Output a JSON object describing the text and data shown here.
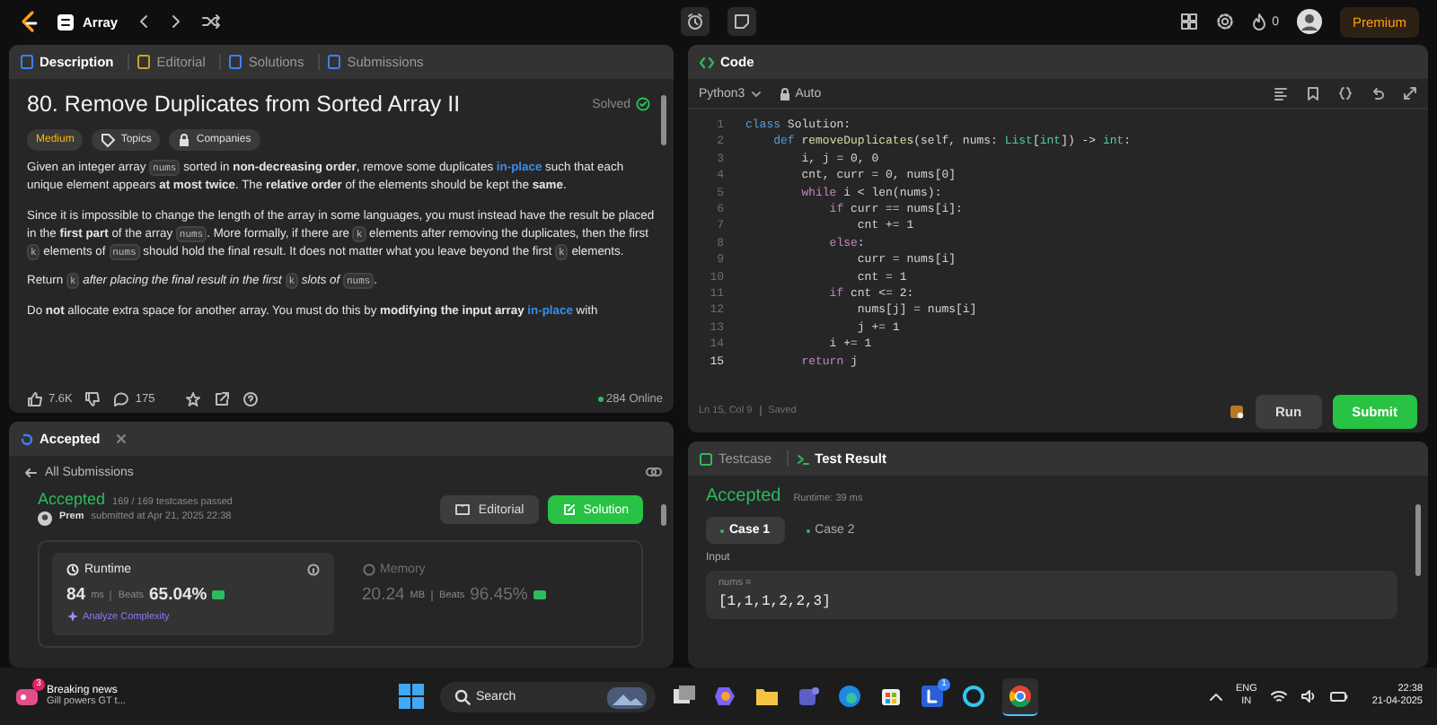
{
  "top_bar": {
    "problem_list": "Array",
    "streak": "0",
    "premium": "Premium"
  },
  "description_panel": {
    "tabs": [
      {
        "label": "Description",
        "selected": true
      },
      {
        "label": "Editorial",
        "selected": false
      },
      {
        "label": "Solutions",
        "selected": false
      },
      {
        "label": "Submissions",
        "selected": false
      }
    ],
    "title": "80. Remove Duplicates from Sorted Array II",
    "status": "Solved",
    "difficulty": "Medium",
    "tags": [
      "Topics",
      "Companies"
    ],
    "paragraphs": [
      [
        {
          "kind": "text",
          "text": "Given an integer array "
        },
        {
          "kind": "code",
          "text": "nums"
        },
        {
          "kind": "text",
          "text": " sorted in **non-decreasing order**, remove some duplicates "
        },
        {
          "kind": "link",
          "text": "in-place"
        },
        {
          "kind": "text",
          "text": " such that each unique element appears **at most twice**. The **relative order** of the elements should be kept the **same**."
        }
      ],
      [
        {
          "kind": "text",
          "text": "Since it is impossible to change the length of the array in some languages, you must instead have the result be placed in the **first part** of the array "
        },
        {
          "kind": "code",
          "text": "nums"
        },
        {
          "kind": "text",
          "text": ". More formally, if there are "
        },
        {
          "kind": "code",
          "text": "k"
        },
        {
          "kind": "text",
          "text": " elements after removing the duplicates, then the first "
        },
        {
          "kind": "code",
          "text": "k"
        },
        {
          "kind": "text",
          "text": " elements of "
        },
        {
          "kind": "code",
          "text": "nums"
        },
        {
          "kind": "text",
          "text": " should hold the final result. It does not matter what you leave beyond the first "
        },
        {
          "kind": "code",
          "text": "k"
        },
        {
          "kind": "text",
          "text": " elements."
        }
      ],
      [
        {
          "kind": "text",
          "text": "Return "
        },
        {
          "kind": "code",
          "text": "k"
        },
        {
          "kind": "text",
          "text": " *after placing the final result in the first* "
        },
        {
          "kind": "code",
          "text": "k"
        },
        {
          "kind": "text",
          "text": " *slots of* "
        },
        {
          "kind": "code",
          "text": "nums"
        },
        {
          "kind": "text",
          "text": "."
        }
      ],
      [
        {
          "kind": "text",
          "text": "Do **not** allocate extra space for another array. You must do this by **modifying the input array** "
        },
        {
          "kind": "link",
          "text": "in-place"
        },
        {
          "kind": "text",
          "text": " with"
        }
      ]
    ],
    "footer": {
      "likes": "7.6K",
      "comments": "175",
      "online": "284 Online"
    }
  },
  "result_panel": {
    "tab": "Accepted",
    "back_link": "All Submissions",
    "status": "Accepted",
    "testcases": "169 / 169 testcases passed",
    "user": "Prem",
    "submitted": "submitted at Apr 21, 2025 22:38",
    "buttons": [
      {
        "label": "Editorial",
        "kind": "secondary"
      },
      {
        "label": "Solution",
        "kind": "primary"
      }
    ],
    "metrics": [
      {
        "label": "Runtime",
        "value": "84",
        "unit": "ms",
        "beats_label": "Beats",
        "beats": "65.04%",
        "link": "Analyze Complexity",
        "selected": true
      },
      {
        "label": "Memory",
        "value": "20.24",
        "unit": "MB",
        "beats_label": "Beats",
        "beats": "96.45%",
        "selected": false
      }
    ]
  },
  "code_panel": {
    "title": "Code",
    "language": "Python3",
    "mode": "Auto",
    "lines": [
      {
        "number": "1",
        "current": false,
        "tokens": [
          {
            "kind": "kw",
            "text": "class"
          },
          {
            "kind": "tx",
            "text": " Solution:"
          }
        ]
      },
      {
        "number": "2",
        "current": false,
        "tokens": [
          {
            "kind": "kw",
            "text": "    def"
          },
          {
            "kind": "fn",
            "text": " removeDuplicates"
          },
          {
            "kind": "tx",
            "text": "(self, nums: "
          },
          {
            "kind": "ty",
            "text": "List"
          },
          {
            "kind": "tx",
            "text": "["
          },
          {
            "kind": "ty",
            "text": "int"
          },
          {
            "kind": "tx",
            "text": "]) -> "
          },
          {
            "kind": "ty",
            "text": "int"
          },
          {
            "kind": "tx",
            "text": ":"
          }
        ]
      },
      {
        "number": "3",
        "current": false,
        "tokens": [
          {
            "kind": "tx",
            "text": "        i, j = 0, 0"
          }
        ]
      },
      {
        "number": "4",
        "current": false,
        "tokens": [
          {
            "kind": "tx",
            "text": "        cnt, curr = 0, nums[0]"
          }
        ]
      },
      {
        "number": "5",
        "current": false,
        "tokens": [
          {
            "kind": "ctl",
            "text": "        while"
          },
          {
            "kind": "tx",
            "text": " i < len(nums):"
          }
        ]
      },
      {
        "number": "6",
        "current": false,
        "tokens": [
          {
            "kind": "ctl",
            "text": "            if"
          },
          {
            "kind": "tx",
            "text": " curr == nums[i]:"
          }
        ]
      },
      {
        "number": "7",
        "current": false,
        "tokens": [
          {
            "kind": "tx",
            "text": "                cnt += 1"
          }
        ]
      },
      {
        "number": "8",
        "current": false,
        "tokens": [
          {
            "kind": "ctl",
            "text": "            else"
          },
          {
            "kind": "tx",
            "text": ":"
          }
        ]
      },
      {
        "number": "9",
        "current": false,
        "tokens": [
          {
            "kind": "tx",
            "text": "                curr = nums[i]"
          }
        ]
      },
      {
        "number": "10",
        "current": false,
        "tokens": [
          {
            "kind": "tx",
            "text": "                cnt = 1"
          }
        ]
      },
      {
        "number": "11",
        "current": false,
        "tokens": [
          {
            "kind": "ctl",
            "text": "            if"
          },
          {
            "kind": "tx",
            "text": " cnt <= 2:"
          }
        ]
      },
      {
        "number": "12",
        "current": false,
        "tokens": [
          {
            "kind": "tx",
            "text": "                nums[j] = nums[i]"
          }
        ]
      },
      {
        "number": "13",
        "current": false,
        "tokens": [
          {
            "kind": "tx",
            "text": "                j += 1"
          }
        ]
      },
      {
        "number": "14",
        "current": false,
        "tokens": [
          {
            "kind": "tx",
            "text": "            i += 1"
          }
        ]
      },
      {
        "number": "15",
        "current": true,
        "tokens": [
          {
            "kind": "ctl",
            "text": "        return"
          },
          {
            "kind": "tx",
            "text": " j"
          }
        ]
      }
    ],
    "status": [
      "Ln 15, Col 9",
      "Saved"
    ],
    "buttons": [
      {
        "label": "Run",
        "kind": "secondary"
      },
      {
        "label": "Submit",
        "kind": "primary"
      }
    ]
  },
  "test_panel": {
    "tabs": [
      {
        "label": "Testcase",
        "selected": false
      },
      {
        "label": "Test Result",
        "selected": true
      }
    ],
    "verdict": "Accepted",
    "runtime": "Runtime: 39 ms",
    "cases": [
      {
        "label": "Case 1",
        "selected": true
      },
      {
        "label": "Case 2",
        "selected": false
      }
    ],
    "input_label": "Input",
    "param": "nums =",
    "value": "[1,1,1,2,2,3]"
  },
  "taskbar": {
    "news_badge": "3",
    "news_title": "Breaking news",
    "news_text": "Gill powers GT t...",
    "search": {
      "placeholder": "Search"
    },
    "app_badge": "1",
    "language": [
      "ENG",
      "IN"
    ],
    "time": "22:38",
    "date": "21-04-2025"
  }
}
